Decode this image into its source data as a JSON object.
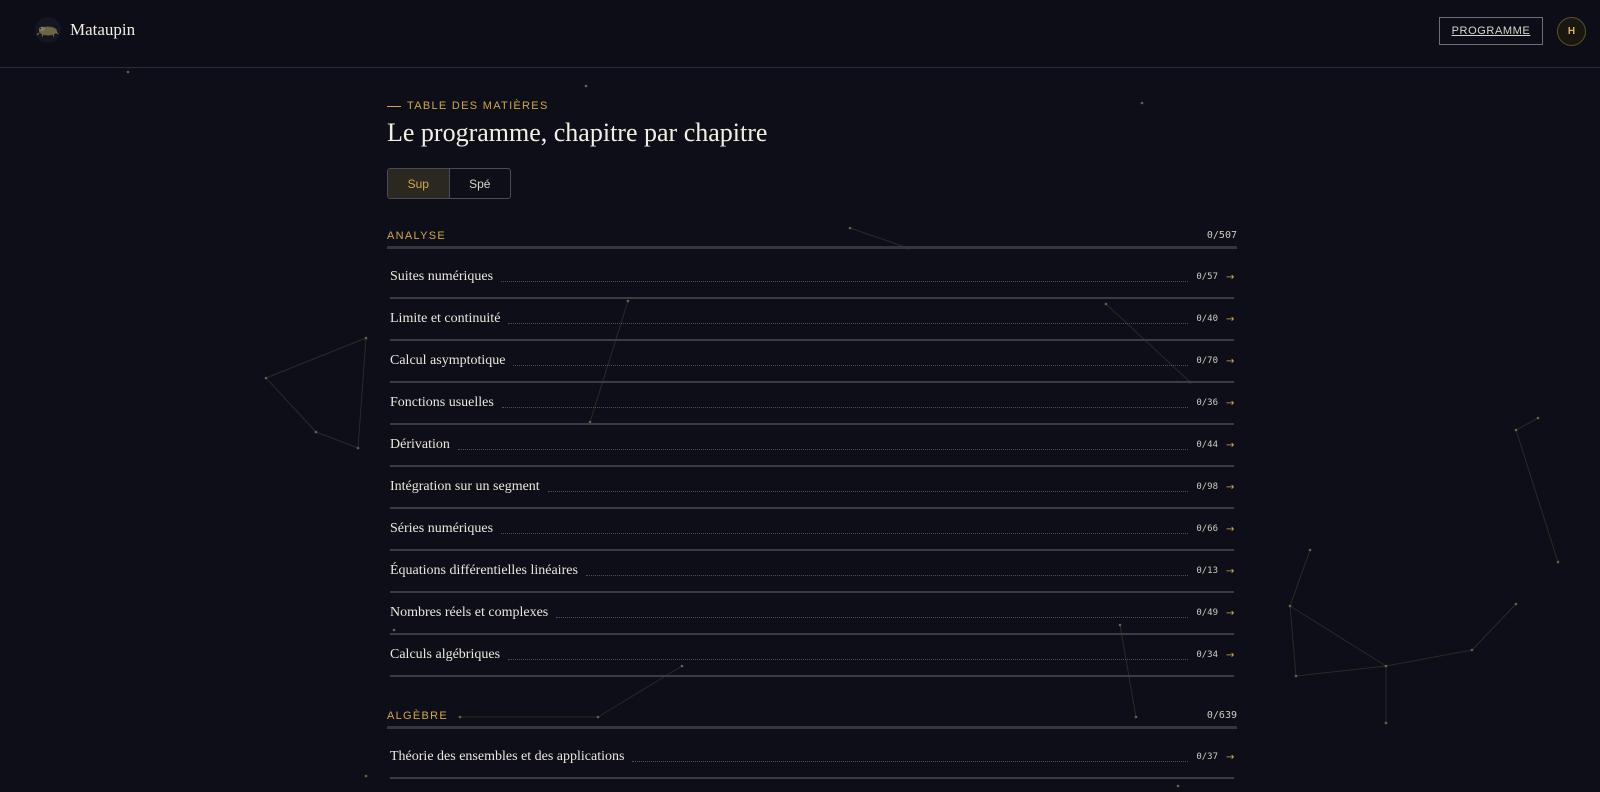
{
  "header": {
    "brand": "Mataupin",
    "nav_programme": "PROGRAMME",
    "avatar_initial": "H"
  },
  "page": {
    "eyebrow": "TABLE DES MATIÈRES",
    "title": "Le programme, chapitre par chapitre",
    "toggle": [
      {
        "label": "Sup",
        "active": true
      },
      {
        "label": "Spé",
        "active": false
      }
    ]
  },
  "sections": [
    {
      "name": "ANALYSE",
      "count": "0/507",
      "chapters": [
        {
          "name": "Suites numériques",
          "count": "0/57"
        },
        {
          "name": "Limite et continuité",
          "count": "0/40"
        },
        {
          "name": "Calcul asymptotique",
          "count": "0/70"
        },
        {
          "name": "Fonctions usuelles",
          "count": "0/36"
        },
        {
          "name": "Dérivation",
          "count": "0/44"
        },
        {
          "name": "Intégration sur un segment",
          "count": "0/98"
        },
        {
          "name": "Séries numériques",
          "count": "0/66"
        },
        {
          "name": "Équations différentielles linéaires",
          "count": "0/13"
        },
        {
          "name": "Nombres réels et complexes",
          "count": "0/49"
        },
        {
          "name": "Calculs algébriques",
          "count": "0/34"
        }
      ]
    },
    {
      "name": "ALGÈBRE",
      "count": "0/639",
      "chapters": [
        {
          "name": "Théorie des ensembles et des applications",
          "count": "0/37"
        }
      ]
    }
  ],
  "colors": {
    "background": "#0d0e17",
    "accent": "#d3a64a",
    "text": "#ece8dd"
  },
  "icons": {
    "chapter_arrow": "arrow-right-icon",
    "brand_logo": "mole-logo-icon"
  }
}
